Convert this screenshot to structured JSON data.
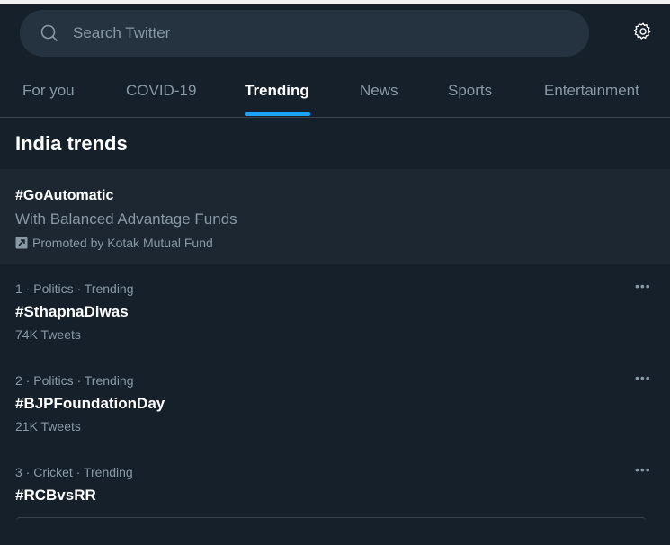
{
  "search": {
    "placeholder": "Search Twitter"
  },
  "tabs": [
    {
      "label": "For you"
    },
    {
      "label": "COVID-19"
    },
    {
      "label": "Trending"
    },
    {
      "label": "News"
    },
    {
      "label": "Sports"
    },
    {
      "label": "Entertainment"
    }
  ],
  "active_tab": "Trending",
  "section_title": "India trends",
  "promoted": {
    "hashtag": "#GoAutomatic",
    "description": "With Balanced Advantage Funds",
    "promoted_by": "Promoted by Kotak Mutual Fund"
  },
  "trends": [
    {
      "meta": "1 · Politics · Trending",
      "name": "#SthapnaDiwas",
      "count": "74K Tweets"
    },
    {
      "meta": "2 · Politics · Trending",
      "name": "#BJPFoundationDay",
      "count": "21K Tweets"
    },
    {
      "meta": "3 · Cricket · Trending",
      "name": "#RCBvsRR",
      "count": ""
    }
  ],
  "more_label": "•••",
  "colors": {
    "accent": "#1da1f2",
    "background": "#15202b",
    "secondary_text": "#8899a6"
  }
}
